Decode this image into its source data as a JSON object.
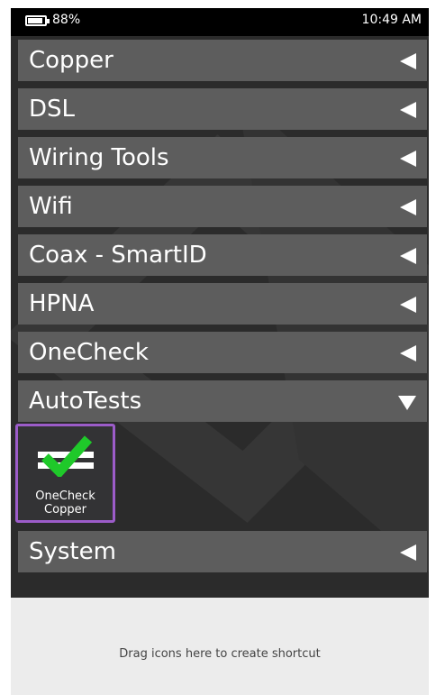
{
  "status_bar": {
    "battery_percent": "88%",
    "time": "10:49 AM",
    "battery_icon": "battery-icon"
  },
  "menu": {
    "items": [
      {
        "label": "Copper",
        "expanded": false
      },
      {
        "label": "DSL",
        "expanded": false
      },
      {
        "label": "Wiring Tools",
        "expanded": false
      },
      {
        "label": "Wifi",
        "expanded": false
      },
      {
        "label": "Coax - SmartID",
        "expanded": false
      },
      {
        "label": "HPNA",
        "expanded": false
      },
      {
        "label": "OneCheck",
        "expanded": false
      },
      {
        "label": "AutoTests",
        "expanded": true
      },
      {
        "label": "System",
        "expanded": false
      }
    ],
    "autotests_tiles": [
      {
        "line1": "OneCheck",
        "line2": "Copper",
        "icon": "checkmark-icon"
      }
    ]
  },
  "dropzone": {
    "hint": "Drag icons here to create shortcut"
  },
  "colors": {
    "menu_bar": "#5d5d5d",
    "background": "#2b2b2b",
    "tile_border": "#9c5cc9",
    "check": "#1fc92a",
    "dropzone": "#ececec"
  }
}
